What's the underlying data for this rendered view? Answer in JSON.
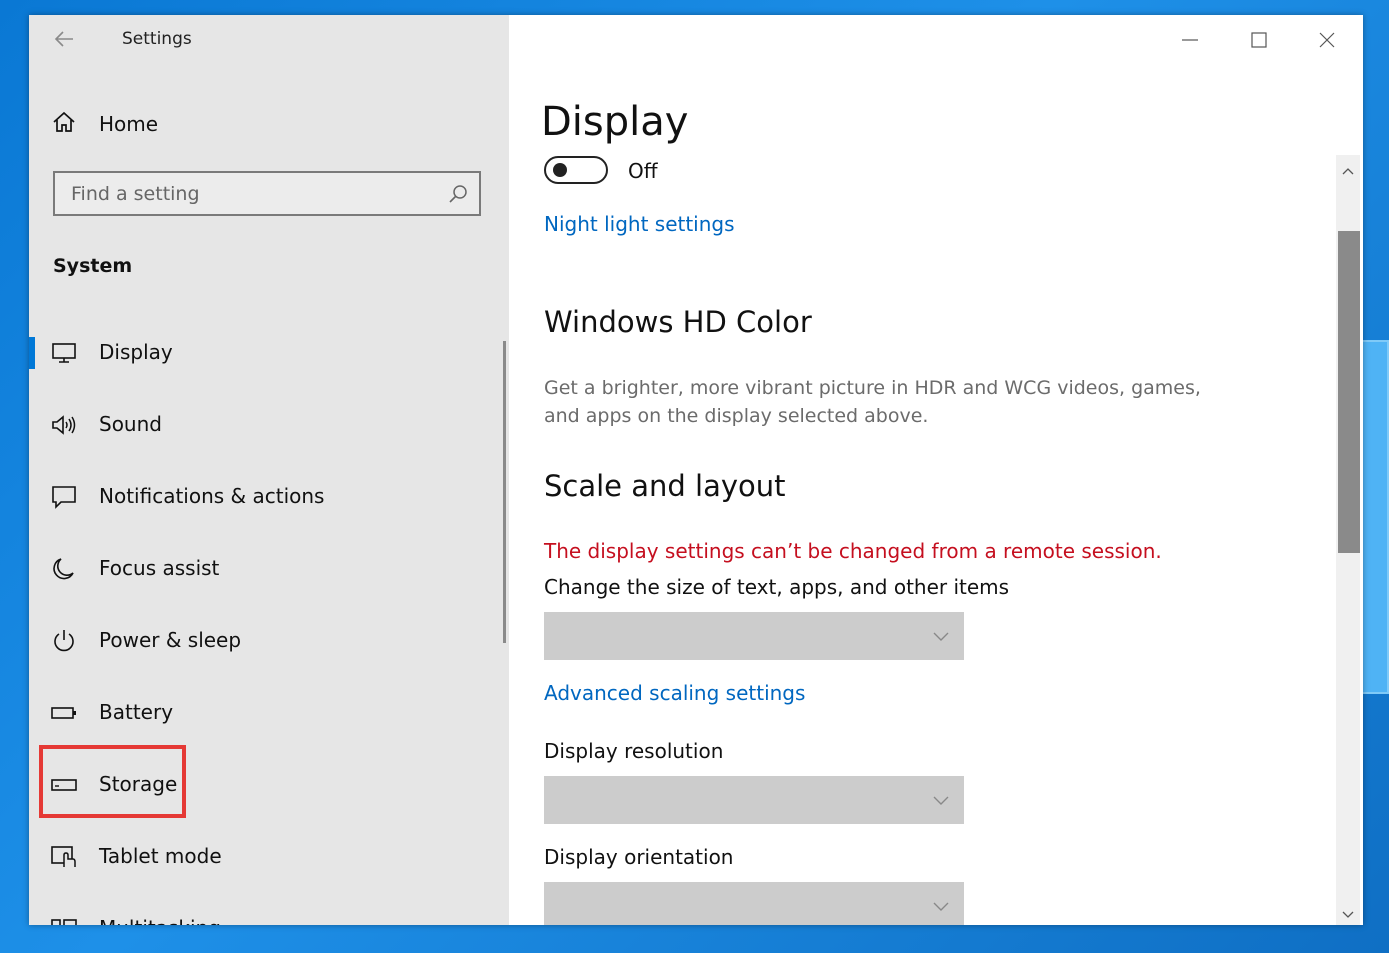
{
  "window": {
    "title": "Settings",
    "controls": {
      "minimize": "minimize-icon",
      "maximize": "maximize-icon",
      "close": "close-icon"
    }
  },
  "sidebar": {
    "home_label": "Home",
    "search": {
      "placeholder": "Find a setting"
    },
    "section_title": "System",
    "items": [
      {
        "label": "Display",
        "icon": "monitor-icon",
        "active": true
      },
      {
        "label": "Sound",
        "icon": "speaker-icon"
      },
      {
        "label": "Notifications & actions",
        "icon": "notification-icon"
      },
      {
        "label": "Focus assist",
        "icon": "moon-icon"
      },
      {
        "label": "Power & sleep",
        "icon": "power-icon"
      },
      {
        "label": "Battery",
        "icon": "battery-icon"
      },
      {
        "label": "Storage",
        "icon": "storage-drive-icon",
        "highlighted": true
      },
      {
        "label": "Tablet mode",
        "icon": "tablet-mode-icon"
      },
      {
        "label": "Multitasking",
        "icon": "multitasking-icon"
      }
    ]
  },
  "main": {
    "title": "Display",
    "night_light": {
      "state": "Off",
      "link": "Night light settings"
    },
    "hd_color": {
      "heading": "Windows HD Color",
      "description": "Get a brighter, more vibrant picture in HDR and WCG videos, games, and apps on the display selected above."
    },
    "scale_layout": {
      "heading": "Scale and layout",
      "warning": "The display settings can’t be changed from a remote session.",
      "size_label": "Change the size of text, apps, and other items",
      "advanced_link": "Advanced scaling settings",
      "resolution_label": "Display resolution",
      "orientation_label": "Display orientation"
    }
  },
  "colors": {
    "accent": "#0078d7",
    "link": "#0067c0",
    "warning": "#c50f1f",
    "highlight_box": "#e53935"
  }
}
